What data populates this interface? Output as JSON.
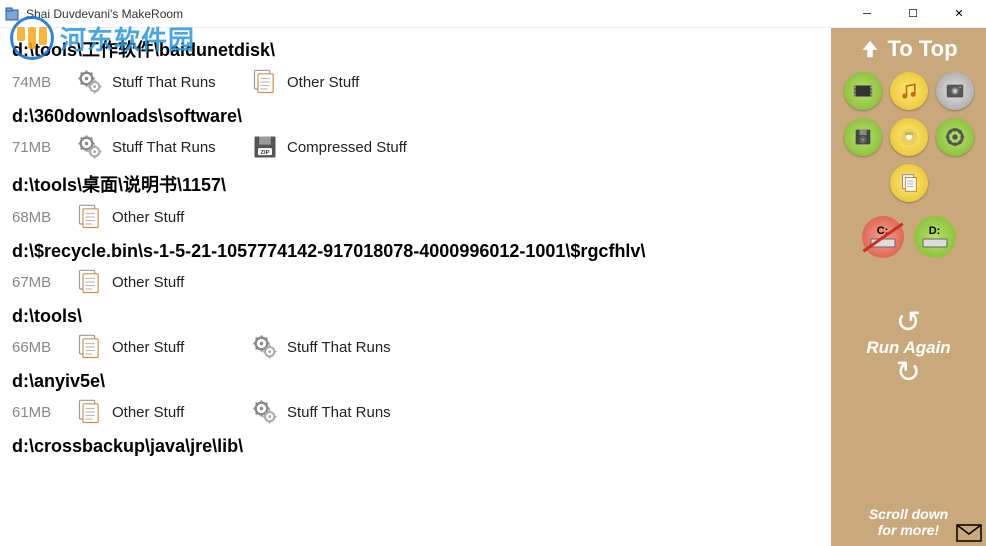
{
  "window": {
    "title": "Shai Duvdevani's MakeRoom"
  },
  "watermark": {
    "text": "河东软件园"
  },
  "sidebar": {
    "to_top": "To Top",
    "drive_c": "C:",
    "drive_d": "D:",
    "run_again": "Run Again",
    "scroll_hint": "Scroll down\nfor more!"
  },
  "categories": {
    "stuff_that_runs": "Stuff That Runs",
    "other_stuff": "Other Stuff",
    "compressed_stuff": "Compressed Stuff"
  },
  "entries": [
    {
      "path": "d:\\tools\\工作软件\\baidunetdisk\\",
      "size": "74MB",
      "cats": [
        "gear:stuff_that_runs",
        "docs:other_stuff"
      ]
    },
    {
      "path": "d:\\360downloads\\software\\",
      "size": "71MB",
      "cats": [
        "gear:stuff_that_runs",
        "zip:compressed_stuff"
      ]
    },
    {
      "path": "d:\\tools\\桌面\\说明书\\1157\\",
      "size": "68MB",
      "cats": [
        "docs:other_stuff"
      ]
    },
    {
      "path": "d:\\$recycle.bin\\s-1-5-21-1057774142-917018078-4000996012-1001\\$rgcfhlv\\",
      "size": "67MB",
      "cats": [
        "docs:other_stuff"
      ]
    },
    {
      "path": "d:\\tools\\",
      "size": "66MB",
      "cats": [
        "docs:other_stuff",
        "gear:stuff_that_runs"
      ]
    },
    {
      "path": "d:\\anyiv5e\\",
      "size": "61MB",
      "cats": [
        "docs:other_stuff",
        "gear:stuff_that_runs"
      ]
    },
    {
      "path": "d:\\crossbackup\\java\\jre\\lib\\",
      "size": "",
      "cats": []
    }
  ]
}
